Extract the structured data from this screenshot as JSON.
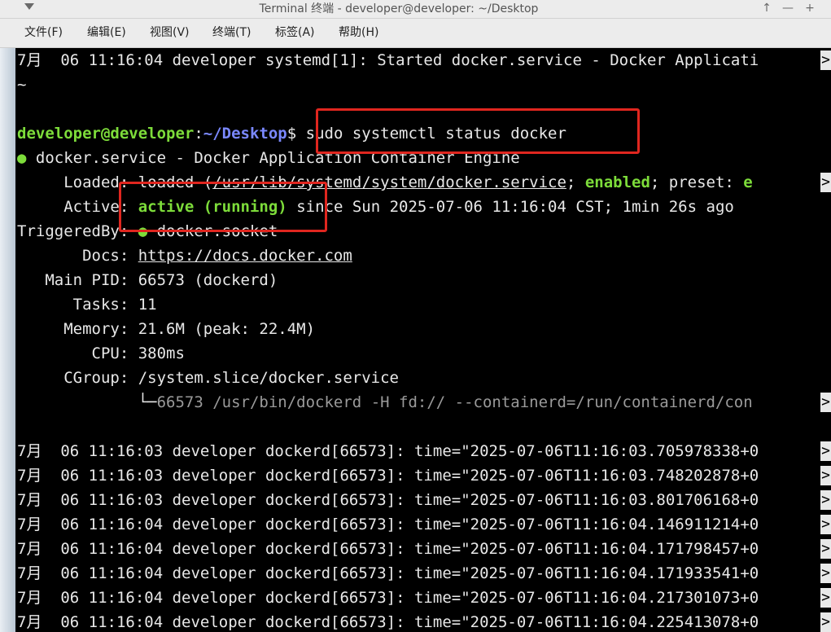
{
  "window": {
    "title": "Terminal 终端 - developer@developer: ~/Desktop",
    "buttons": {
      "up": "↑",
      "minimize": "—",
      "maximize": "+"
    }
  },
  "menu": [
    "文件(F)",
    "编辑(E)",
    "视图(V)",
    "终端(T)",
    "标签(A)",
    "帮助(H)"
  ],
  "terminal": {
    "top_line": "7月  06 11:16:04 developer systemd[1]: Started docker.service - Docker Applicati",
    "tilde": "~",
    "prompt_user": "developer@developer",
    "prompt_sep": ":",
    "prompt_path": "~/Desktop",
    "prompt_dollar": "$",
    "command": " sudo systemctl status docker",
    "service_dot": "●",
    "service_line": " docker.service - Docker Application Container Engine",
    "loaded_label": "     Loaded: ",
    "loaded_value": "loaded (",
    "loaded_path": "/usr/lib/systemd/system/docker.service",
    "loaded_sep": "; ",
    "loaded_enabled": "enabled",
    "loaded_rest": "; preset: ",
    "loaded_preset": "e",
    "active_label": "     Active: ",
    "active_value": "active (running)",
    "active_rest": " since Sun 2025-07-06 11:16:04 CST; 1min 26s ago",
    "triggered_label": "TriggeredBy: ",
    "triggered_value": " docker.socket",
    "docs_label": "       Docs: ",
    "docs_value": "https://docs.docker.com",
    "mainpid": "   Main PID: 66573 (dockerd)",
    "tasks": "      Tasks: 11",
    "memory": "     Memory: 21.6M (peak: 22.4M)",
    "cpu": "        CPU: 380ms",
    "cgroup": "     CGroup: /system.slice/docker.service",
    "cgroup_tree": "             └─",
    "cgroup_proc": "66573 /usr/bin/dockerd -H fd:// --containerd=/run/containerd/con",
    "truncation_marker": ">",
    "logs": [
      "7月  06 11:16:03 developer dockerd[66573]: time=\"2025-07-06T11:16:03.705978338+0",
      "7月  06 11:16:03 developer dockerd[66573]: time=\"2025-07-06T11:16:03.748202878+0",
      "7月  06 11:16:03 developer dockerd[66573]: time=\"2025-07-06T11:16:03.801706168+0",
      "7月  06 11:16:04 developer dockerd[66573]: time=\"2025-07-06T11:16:04.146911214+0",
      "7月  06 11:16:04 developer dockerd[66573]: time=\"2025-07-06T11:16:04.171798457+0",
      "7月  06 11:16:04 developer dockerd[66573]: time=\"2025-07-06T11:16:04.171933541+0",
      "7月  06 11:16:04 developer dockerd[66573]: time=\"2025-07-06T11:16:04.217301073+0",
      "7月  06 11:16:04 developer dockerd[66573]: time=\"2025-07-06T11:16:04.225413078+0"
    ]
  },
  "colors": {
    "terminal_bg": "#000000",
    "prompt_green": "#7ddc3a",
    "path_blue": "#7a88ff",
    "highlight_red": "#e0261f"
  }
}
